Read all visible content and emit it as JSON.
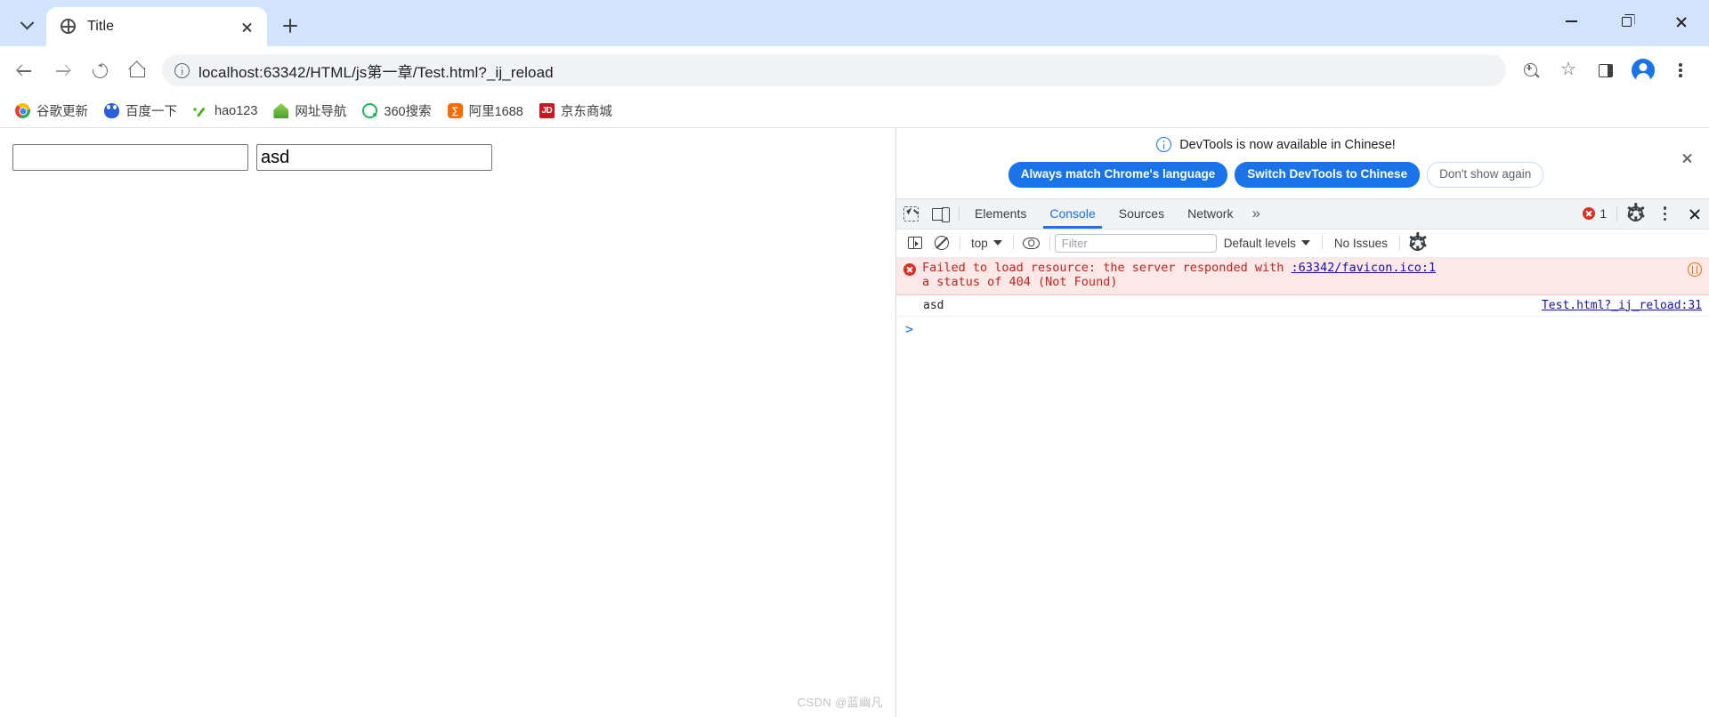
{
  "browser": {
    "tab": {
      "title": "Title",
      "favicon": "globe-icon"
    },
    "new_tab_label": "+",
    "window_controls": {
      "minimize": "minimize-icon",
      "maximize": "maximize-icon",
      "close": "close-icon"
    },
    "toolbar": {
      "back": "back-arrow-icon",
      "forward": "forward-arrow-icon",
      "reload": "reload-icon",
      "home": "home-icon",
      "site_info": "info-icon",
      "url": "localhost:63342/HTML/js第一章/Test.html?_ij_reload",
      "zoom": "zoom-icon",
      "bookmark": "star-icon",
      "side_panel": "side-panel-icon",
      "profile": "avatar-icon",
      "menu": "kebab-menu-icon"
    },
    "bookmarks": [
      {
        "label": "谷歌更新",
        "icon": "chrome-icon"
      },
      {
        "label": "百度一下",
        "icon": "baidu-icon"
      },
      {
        "label": "hao123",
        "icon": "hao123-icon"
      },
      {
        "label": "网址导航",
        "icon": "2345-icon"
      },
      {
        "label": "360搜索",
        "icon": "360-icon"
      },
      {
        "label": "阿里1688",
        "icon": "alibaba-icon"
      },
      {
        "label": "京东商城",
        "icon": "jd-icon"
      }
    ]
  },
  "page": {
    "inputs": [
      {
        "name": "text-input-1",
        "value": "",
        "placeholder": ""
      },
      {
        "name": "text-input-2",
        "value": "asd",
        "placeholder": ""
      }
    ],
    "watermark": "CSDN @蓝幽凡"
  },
  "devtools": {
    "banner": {
      "message": "DevTools is now available in Chinese!",
      "buttons": [
        {
          "label": "Always match Chrome's language",
          "style": "primary"
        },
        {
          "label": "Switch DevTools to Chinese",
          "style": "primary"
        },
        {
          "label": "Don't show again",
          "style": "ghost"
        }
      ],
      "close": "close-icon"
    },
    "tabs": [
      {
        "label": "Elements",
        "active": false
      },
      {
        "label": "Console",
        "active": true
      },
      {
        "label": "Sources",
        "active": false
      },
      {
        "label": "Network",
        "active": false
      }
    ],
    "more_tabs": "»",
    "error_count": "1",
    "icons": {
      "inspect": "inspect-element-icon",
      "device": "device-toolbar-icon",
      "settings": "gear-icon",
      "dock_menu": "kebab-menu-icon",
      "close": "close-icon"
    },
    "filterbar": {
      "sidebar_toggle": "console-sidebar-icon",
      "clear_console": "clear-console-icon",
      "context": "top",
      "live_expression": "eye-icon",
      "filter_placeholder": "Filter",
      "filter_value": "",
      "levels": "Default levels",
      "issues": "No Issues",
      "settings": "gear-icon"
    },
    "messages": [
      {
        "type": "error",
        "text_part1": "Failed to load resource: the server responded with",
        "link": ":63342/favicon.ico:1",
        "text_part2": "a status of 404 (Not Found)",
        "badge": "network-issue-icon"
      },
      {
        "type": "log",
        "text": "asd",
        "source": "Test.html?_ij_reload:31"
      }
    ],
    "prompt": ">"
  },
  "colors": {
    "accent": "#1a73e8",
    "error": "#d93025",
    "error_bg": "#fce8e6",
    "tabstrip": "#d3e3fd",
    "link": "#1a0dab"
  }
}
